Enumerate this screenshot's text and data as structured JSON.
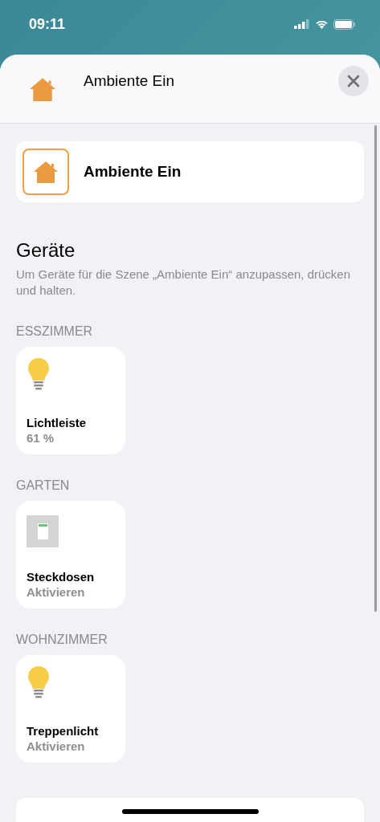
{
  "status_bar": {
    "time": "09:11"
  },
  "sheet": {
    "title": "Ambiente Ein"
  },
  "scene_card": {
    "name": "Ambiente Ein"
  },
  "devices_section": {
    "title": "Geräte",
    "hint": "Um Geräte für die Szene „Ambiente Ein“ anzupassen, drücken und halten."
  },
  "rooms": [
    {
      "name": "ESSZIMMER",
      "devices": [
        {
          "kind": "light",
          "name": "Lichtleiste",
          "status": "61 %"
        }
      ]
    },
    {
      "name": "GARTEN",
      "devices": [
        {
          "kind": "outlet",
          "name": "Steckdosen",
          "status": "Aktivieren"
        }
      ]
    },
    {
      "name": "WOHNZIMMER",
      "devices": [
        {
          "kind": "light",
          "name": "Treppenlicht",
          "status": "Aktivieren"
        }
      ]
    }
  ]
}
